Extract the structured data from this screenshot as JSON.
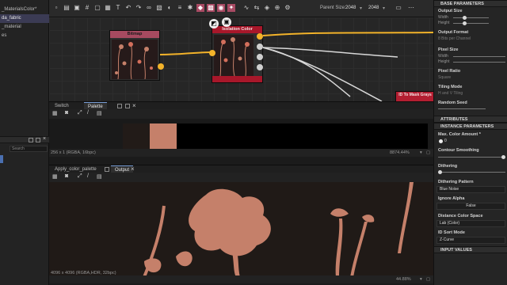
{
  "left_panel": {
    "file_name": "_MaterialsColor*",
    "items": [
      "da_fabric",
      "_material",
      "es"
    ],
    "search_label": "Search",
    "selected_index": 0
  },
  "toolbar": {
    "parent_size_label": "Parent Size:",
    "size_width": "2048",
    "size_height": "2048",
    "icons": [
      "new-icon",
      "open-icon",
      "save-icon",
      "grid-icon",
      "frame-icon",
      "image-icon",
      "text-icon",
      "undo-icon",
      "redo-icon",
      "link-icon",
      "bitmap-icon",
      "color-icon",
      "layers-icon",
      "settings-icon",
      "filter-icon",
      "tiles-icon",
      "preview-icon",
      "pin-icon",
      "wave-icon",
      "share-icon",
      "cube-icon",
      "node-icon",
      "gear-icon"
    ]
  },
  "graph": {
    "bitmap_node_title": "Bitmap",
    "isolation_node_title": "Isolation Color",
    "id_mask_node_title": "ID To Mask Grays",
    "colors": {
      "bitmap_header": "#a64a60",
      "isolation_header": "#a8172a",
      "id_mask_header": "#b31e31",
      "link_orange": "#f3b32a",
      "link_white": "#d8d8d8"
    }
  },
  "switch_panel": {
    "tabs": [
      "Switch",
      "Palette"
    ],
    "active_tab": 1,
    "status": "256 x 1 (RGBA, 16bpc)",
    "zoom": "8874.44%",
    "swatch_color": "#c5806a"
  },
  "output_panel": {
    "tabs": [
      "Apply_color_palette",
      "Output"
    ],
    "active_tab": 1,
    "status": "4096 x 4096 (RGBA,HDR, 32bpc)",
    "zoom": "44.88%",
    "bg_color": "#201a17",
    "shape_color": "#c5806a"
  },
  "right_panel": {
    "base_parameters": "BASE PARAMETERS",
    "output_size": "Output Size",
    "width": "Width",
    "height": "Height",
    "output_format": "Output Format",
    "output_format_value": "8 Bits per Channel",
    "pixel_size": "Pixel Size",
    "pixel_size_width": "Width",
    "pixel_size_height": "Height",
    "pixel_ratio": "Pixel Ratio",
    "pixel_ratio_value": "Square",
    "tiling_mode": "Tiling Mode",
    "tiling_mode_value": "H and V Tiling",
    "random_seed": "Random Seed",
    "attributes": "ATTRIBUTES",
    "instance_parameters": "INSTANCE PARAMETERS",
    "max_color_amount": "Max. Color Amount *",
    "max_color_value": "0",
    "contour_smoothing": "Contour Smoothing",
    "dithering": "Dithering",
    "dithering_pattern": "Dithering Pattern",
    "dithering_pattern_value": "Blue Noise",
    "ignore_alpha": "Ignore Alpha",
    "ignore_alpha_value": "False",
    "distance_color_space": "Distance Color Space",
    "distance_color_space_value": "Lab (Color)",
    "id_sort_mode": "ID Sort Mode",
    "id_sort_mode_value": "Z-Curve",
    "input_values": "INPUT VALUES",
    "contour_smoothing_level": 1.0,
    "dithering_level": 0.0
  }
}
